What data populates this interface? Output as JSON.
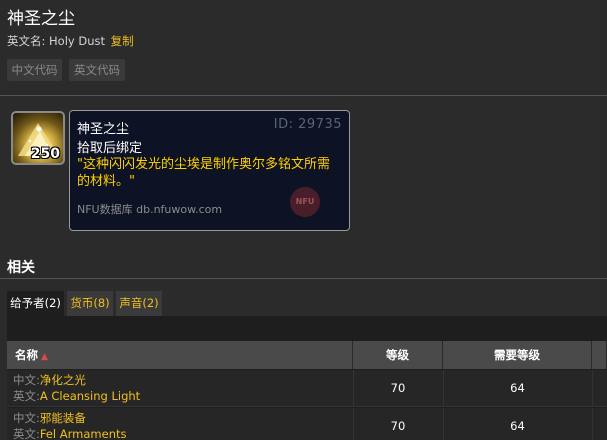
{
  "page": {
    "title": "神圣之尘",
    "english_name_label": "英文名:",
    "english_name": "Holy Dust",
    "copy_label": "复制"
  },
  "code_buttons": [
    "中文代码",
    "英文代码"
  ],
  "item": {
    "icon": "holy-dust-icon",
    "stack_count": "250"
  },
  "tooltip": {
    "name": "神圣之尘",
    "id": "ID: 29735",
    "bind": "拾取后绑定",
    "description": "\"这种闪闪发光的尘埃是制作奥尔多铭文所需的材料。\"",
    "source": "NFU数据库 db.nfuwow.com",
    "logo_text": "NFU"
  },
  "related": {
    "title": "相关",
    "tabs": [
      "给予者(2)",
      "货币(8)",
      "声音(2)"
    ],
    "active_tab": 0,
    "columns": [
      "名称",
      "等级",
      "需要等级"
    ],
    "rows": [
      {
        "cn_prefix": "中文:",
        "cn": "净化之光",
        "en_prefix": "英文:",
        "en": "A Cleansing Light",
        "level": "70",
        "req_level": "64"
      },
      {
        "cn_prefix": "中文:",
        "cn": "邪能装备",
        "en_prefix": "英文:",
        "en": "Fel Armaments",
        "level": "70",
        "req_level": "64"
      }
    ]
  },
  "colors": {
    "background": "#2b2b2b",
    "accent_yellow": "#f0c020",
    "tooltip_bg": "#0d1224",
    "tooltip_desc": "#ffd100"
  }
}
